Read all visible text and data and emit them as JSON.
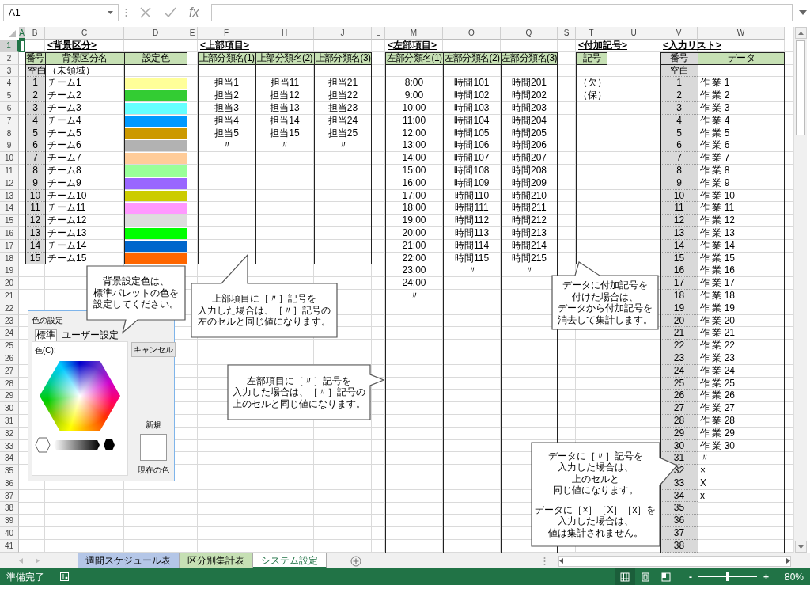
{
  "formula_bar": {
    "name_box": "A1",
    "function_label": "fx"
  },
  "columns": [
    {
      "label": "A",
      "selected": true
    },
    {
      "label": "B",
      "selected": false
    },
    {
      "label": "C",
      "selected": false
    },
    {
      "label": "D",
      "selected": false
    },
    {
      "label": "E",
      "selected": false
    },
    {
      "label": "F",
      "selected": false
    },
    {
      "label": "H",
      "selected": false
    },
    {
      "label": "J",
      "selected": false
    },
    {
      "label": "L",
      "selected": false
    },
    {
      "label": "M",
      "selected": false
    },
    {
      "label": "O",
      "selected": false
    },
    {
      "label": "Q",
      "selected": false
    },
    {
      "label": "S",
      "selected": false
    },
    {
      "label": "T",
      "selected": false
    },
    {
      "label": "U",
      "selected": false
    },
    {
      "label": "V",
      "selected": false
    },
    {
      "label": "W",
      "selected": false
    }
  ],
  "rows": [
    {
      "label": "1",
      "selected": true
    },
    {
      "label": "2",
      "selected": false
    },
    {
      "label": "3",
      "selected": false
    },
    {
      "label": "4",
      "selected": false
    },
    {
      "label": "5",
      "selected": false
    },
    {
      "label": "6",
      "selected": false
    },
    {
      "label": "7",
      "selected": false
    },
    {
      "label": "8",
      "selected": false
    },
    {
      "label": "9",
      "selected": false
    },
    {
      "label": "10",
      "selected": false
    },
    {
      "label": "11",
      "selected": false
    },
    {
      "label": "12",
      "selected": false
    },
    {
      "label": "13",
      "selected": false
    },
    {
      "label": "14",
      "selected": false
    },
    {
      "label": "15",
      "selected": false
    },
    {
      "label": "16",
      "selected": false
    },
    {
      "label": "17",
      "selected": false
    },
    {
      "label": "18",
      "selected": false
    },
    {
      "label": "19",
      "selected": false
    },
    {
      "label": "20",
      "selected": false
    },
    {
      "label": "21",
      "selected": false
    },
    {
      "label": "22",
      "selected": false
    },
    {
      "label": "23",
      "selected": false
    },
    {
      "label": "24",
      "selected": false
    },
    {
      "label": "25",
      "selected": false
    },
    {
      "label": "26",
      "selected": false
    },
    {
      "label": "27",
      "selected": false
    },
    {
      "label": "28",
      "selected": false
    },
    {
      "label": "29",
      "selected": false
    },
    {
      "label": "30",
      "selected": false
    },
    {
      "label": "31",
      "selected": false
    },
    {
      "label": "32",
      "selected": false
    },
    {
      "label": "33",
      "selected": false
    },
    {
      "label": "34",
      "selected": false
    },
    {
      "label": "35",
      "selected": false
    },
    {
      "label": "36",
      "selected": false
    },
    {
      "label": "37",
      "selected": false
    },
    {
      "label": "38",
      "selected": false
    },
    {
      "label": "39",
      "selected": false
    },
    {
      "label": "40",
      "selected": false
    },
    {
      "label": "41",
      "selected": false
    }
  ],
  "background_table": {
    "title": "<背景区分>",
    "headers": [
      "番号",
      "背景区分名",
      "設定色"
    ],
    "rows": [
      {
        "number": "空白",
        "name": "（未領域）"
      },
      {
        "number": "1",
        "name": "チーム1",
        "color": "#ffff99"
      },
      {
        "number": "2",
        "name": "チーム2",
        "color": "#33cc33"
      },
      {
        "number": "3",
        "name": "チーム3",
        "color": "#66ffff"
      },
      {
        "number": "4",
        "name": "チーム4",
        "color": "#0099ff"
      },
      {
        "number": "5",
        "name": "チーム5",
        "color": "#cc9900"
      },
      {
        "number": "6",
        "name": "チーム6",
        "color": "#b2b2b2"
      },
      {
        "number": "7",
        "name": "チーム7",
        "color": "#ffcc99"
      },
      {
        "number": "8",
        "name": "チーム8",
        "color": "#99ff99"
      },
      {
        "number": "9",
        "name": "チーム9",
        "color": "#9966ff"
      },
      {
        "number": "10",
        "name": "チーム10",
        "color": "#cccc00"
      },
      {
        "number": "11",
        "name": "チーム11",
        "color": "#ff99ff"
      },
      {
        "number": "12",
        "name": "チーム12",
        "color": "#dddddd"
      },
      {
        "number": "13",
        "name": "チーム13",
        "color": "#00ff00"
      },
      {
        "number": "14",
        "name": "チーム14",
        "color": "#0066cc"
      },
      {
        "number": "15",
        "name": "チーム15",
        "color": "#ff6600"
      }
    ]
  },
  "top_items": {
    "title": "<上部項目>",
    "headers": [
      "上部分類名(1)",
      "上部分類名(2)",
      "上部分類名(3)"
    ],
    "rows": [
      [
        "担当1",
        "担当11",
        "担当21"
      ],
      [
        "担当2",
        "担当12",
        "担当22"
      ],
      [
        "担当3",
        "担当13",
        "担当23"
      ],
      [
        "担当4",
        "担当14",
        "担当24"
      ],
      [
        "担当5",
        "担当15",
        "担当25"
      ],
      [
        "〃",
        "〃",
        "〃"
      ]
    ]
  },
  "left_items": {
    "title": "<左部項目>",
    "headers": [
      "左部分類名(1)",
      "左部分類名(2)",
      "左部分類名(3)"
    ],
    "rows": [
      [
        "8:00",
        "時間101",
        "時間201"
      ],
      [
        "9:00",
        "時間102",
        "時間202"
      ],
      [
        "10:00",
        "時間103",
        "時間203"
      ],
      [
        "11:00",
        "時間104",
        "時間204"
      ],
      [
        "12:00",
        "時間105",
        "時間205"
      ],
      [
        "13:00",
        "時間106",
        "時間206"
      ],
      [
        "14:00",
        "時間107",
        "時間207"
      ],
      [
        "15:00",
        "時間108",
        "時間208"
      ],
      [
        "16:00",
        "時間109",
        "時間209"
      ],
      [
        "17:00",
        "時間110",
        "時間210"
      ],
      [
        "18:00",
        "時間111",
        "時間211"
      ],
      [
        "19:00",
        "時間112",
        "時間212"
      ],
      [
        "20:00",
        "時間113",
        "時間213"
      ],
      [
        "21:00",
        "時間114",
        "時間214"
      ],
      [
        "22:00",
        "時間115",
        "時間215"
      ],
      [
        "23:00",
        "〃",
        "〃"
      ],
      [
        "24:00"
      ],
      [
        "〃"
      ]
    ]
  },
  "symbols": {
    "title": "<付加記号>",
    "header": "記号",
    "rows": [
      "（欠）",
      "（保）"
    ]
  },
  "input_list": {
    "title": "<入力リスト>",
    "headers": [
      {
        "label": "番号",
        "color": "#d9d9d9"
      },
      {
        "label": "データ",
        "color": "#c6e0b4"
      }
    ],
    "rows": [
      {
        "number": "空白"
      },
      {
        "number": "1",
        "data": "作 業 1"
      },
      {
        "number": "2",
        "data": "作 業 2"
      },
      {
        "number": "3",
        "data": "作 業 3"
      },
      {
        "number": "4",
        "data": "作 業 4"
      },
      {
        "number": "5",
        "data": "作 業 5"
      },
      {
        "number": "6",
        "data": "作 業 6"
      },
      {
        "number": "7",
        "data": "作 業 7"
      },
      {
        "number": "8",
        "data": "作 業 8"
      },
      {
        "number": "9",
        "data": "作 業 9"
      },
      {
        "number": "10",
        "data": "作 業 10"
      },
      {
        "number": "11",
        "data": "作 業 11"
      },
      {
        "number": "12",
        "data": "作 業 12"
      },
      {
        "number": "13",
        "data": "作 業 13"
      },
      {
        "number": "14",
        "data": "作 業 14"
      },
      {
        "number": "15",
        "data": "作 業 15"
      },
      {
        "number": "16",
        "data": "作 業 16"
      },
      {
        "number": "17",
        "data": "作 業 17"
      },
      {
        "number": "18",
        "data": "作 業 18"
      },
      {
        "number": "19",
        "data": "作 業 19"
      },
      {
        "number": "20",
        "data": "作 業 20"
      },
      {
        "number": "21",
        "data": "作 業 21"
      },
      {
        "number": "22",
        "data": "作 業 22"
      },
      {
        "number": "23",
        "data": "作 業 23"
      },
      {
        "number": "24",
        "data": "作 業 24"
      },
      {
        "number": "25",
        "data": "作 業 25"
      },
      {
        "number": "26",
        "data": "作 業 26"
      },
      {
        "number": "27",
        "data": "作 業 27"
      },
      {
        "number": "28",
        "data": "作 業 28"
      },
      {
        "number": "29",
        "data": "作 業 29"
      },
      {
        "number": "30",
        "data": "作 業 30"
      },
      {
        "number": "31",
        "data": "〃"
      },
      {
        "number": "32",
        "data": "×"
      },
      {
        "number": "33",
        "data": "X"
      },
      {
        "number": "34",
        "data": "x"
      },
      {
        "number": "35"
      },
      {
        "number": "36"
      },
      {
        "number": "37"
      },
      {
        "number": "38"
      }
    ]
  },
  "color_dialog": {
    "title": "色の設定",
    "tabs": [
      {
        "label": "標準",
        "selected": true
      },
      {
        "label": "ユーザー設定",
        "selected": false
      }
    ],
    "color_label": "色(C):",
    "cancel": "キャンセル",
    "new_label": "新規",
    "current_label": "現在の色"
  },
  "callouts": [
    {
      "paragraphs": [
        [
          "背景設定色は、",
          "標準パレットの色を",
          "設定してください。"
        ]
      ]
    },
    {
      "paragraphs": [
        [
          "上部項目に［〃］記号を",
          "入力した場合は、［〃］記号の",
          "左のセルと同じ値になります。"
        ]
      ]
    },
    {
      "paragraphs": [
        [
          "左部項目に［〃］記号を",
          "入力した場合は、［〃］記号の",
          "上のセルと同じ値になります。"
        ]
      ]
    },
    {
      "paragraphs": [
        [
          "データに付加記号を",
          "付けた場合は、",
          "データから付加記号を",
          "消去して集計します。"
        ]
      ]
    },
    {
      "paragraphs": [
        [
          "データに［〃］記号を",
          "入力した場合は、",
          "上のセルと",
          "同じ値になります。"
        ],
        [
          "データに［×］［X］［x］を",
          "入力した場合は、",
          "値は集計されません。"
        ]
      ]
    }
  ],
  "sheet_tabs": [
    {
      "label": "週間スケジュール表",
      "selected": false,
      "color": "#b4c6e7"
    },
    {
      "label": "区分別集計表",
      "selected": false,
      "color": "#c6e0b4"
    },
    {
      "label": "システム設定",
      "selected": true
    }
  ],
  "status_bar": {
    "text": "準備完了",
    "views": [
      {
        "selected": true
      },
      {
        "selected": false
      },
      {
        "selected": false
      }
    ],
    "zoom": {
      "minus": "-",
      "plus": "+",
      "level": 0.5,
      "reading": "80%"
    }
  }
}
